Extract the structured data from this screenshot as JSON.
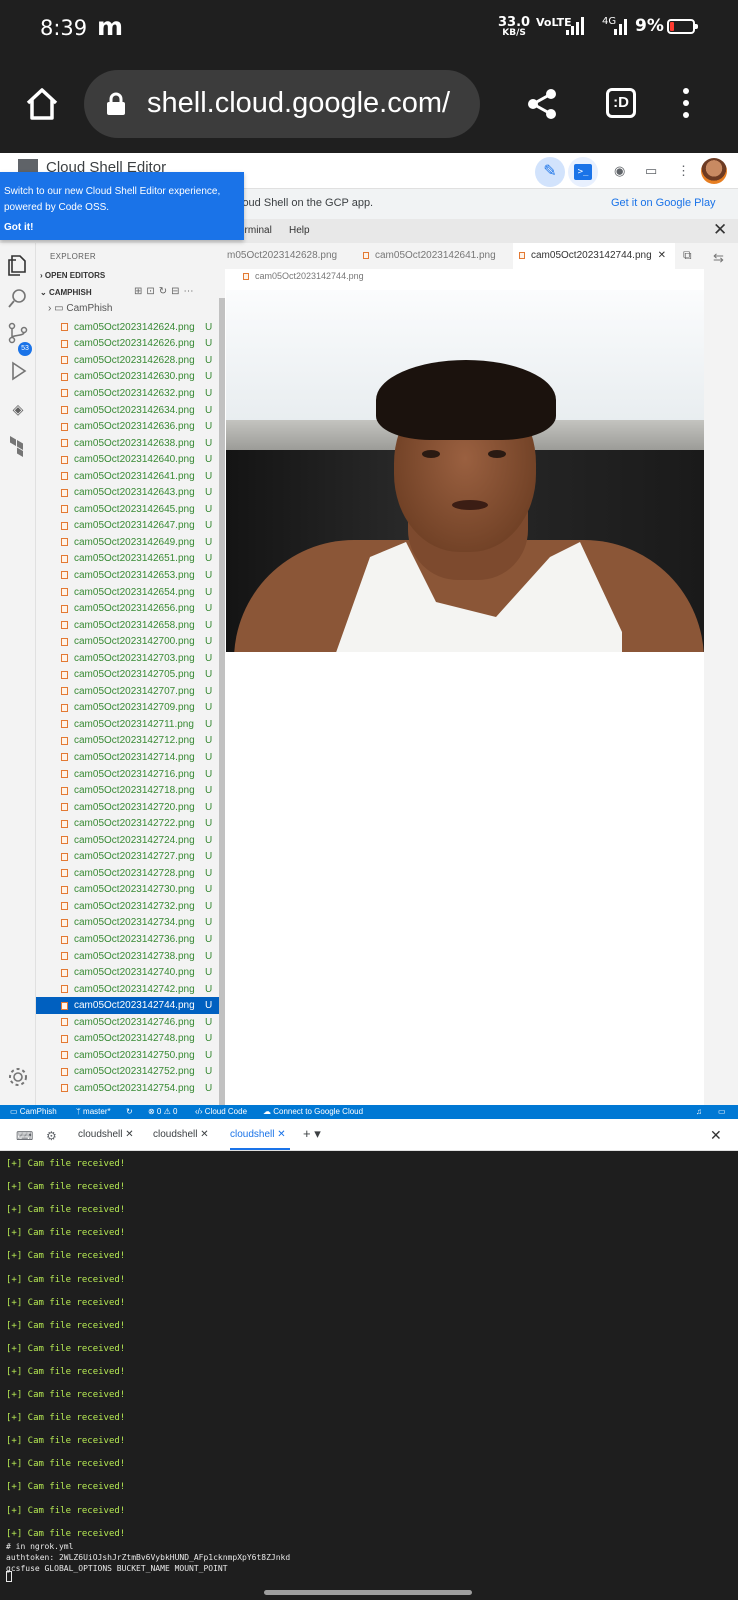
{
  "status_bar": {
    "time": "8:39",
    "app_icon": "m",
    "speed_value": "33.0",
    "speed_unit": "KB/S",
    "volte": "VoLTE",
    "network": "4G",
    "battery": "9%"
  },
  "browser": {
    "url": "shell.cloud.google.com/",
    "tabs_label": ":D"
  },
  "cloud_shell": {
    "title": "Cloud Shell Editor",
    "gcp_banner": "loud Shell on the GCP app.",
    "gcp_link": "Get it on Google Play",
    "menu": [
      "erminal",
      "Help"
    ],
    "promo_text": "Switch to our new Cloud Shell Editor experience, powered by Code OSS.",
    "promo_button": "Got it!"
  },
  "explorer": {
    "header": "EXPLORER",
    "open_editors": "OPEN EDITORS",
    "workspace": "CAMPHISH",
    "folder": "CamPhish",
    "files": [
      "cam05Oct2023142624.png",
      "cam05Oct2023142626.png",
      "cam05Oct2023142628.png",
      "cam05Oct2023142630.png",
      "cam05Oct2023142632.png",
      "cam05Oct2023142634.png",
      "cam05Oct2023142636.png",
      "cam05Oct2023142638.png",
      "cam05Oct2023142640.png",
      "cam05Oct2023142641.png",
      "cam05Oct2023142643.png",
      "cam05Oct2023142645.png",
      "cam05Oct2023142647.png",
      "cam05Oct2023142649.png",
      "cam05Oct2023142651.png",
      "cam05Oct2023142653.png",
      "cam05Oct2023142654.png",
      "cam05Oct2023142656.png",
      "cam05Oct2023142658.png",
      "cam05Oct2023142700.png",
      "cam05Oct2023142703.png",
      "cam05Oct2023142705.png",
      "cam05Oct2023142707.png",
      "cam05Oct2023142709.png",
      "cam05Oct2023142711.png",
      "cam05Oct2023142712.png",
      "cam05Oct2023142714.png",
      "cam05Oct2023142716.png",
      "cam05Oct2023142718.png",
      "cam05Oct2023142720.png",
      "cam05Oct2023142722.png",
      "cam05Oct2023142724.png",
      "cam05Oct2023142727.png",
      "cam05Oct2023142728.png",
      "cam05Oct2023142730.png",
      "cam05Oct2023142732.png",
      "cam05Oct2023142734.png",
      "cam05Oct2023142736.png",
      "cam05Oct2023142738.png",
      "cam05Oct2023142740.png",
      "cam05Oct2023142742.png",
      "cam05Oct2023142744.png",
      "cam05Oct2023142746.png",
      "cam05Oct2023142748.png",
      "cam05Oct2023142750.png",
      "cam05Oct2023142752.png",
      "cam05Oct2023142754.png"
    ],
    "file_status": "U",
    "selected_file": "cam05Oct2023142744.png",
    "scm_badge": "53"
  },
  "editor": {
    "tabs": [
      "m05Oct2023142628.png",
      "cam05Oct2023142641.png",
      "cam05Oct2023142744.png"
    ],
    "active_tab": "cam05Oct2023142744.png",
    "breadcrumb": "cam05Oct2023142744.png"
  },
  "statusbar": {
    "workspace": "CamPhish",
    "branch": "master*",
    "problems": "⊗ 0 ⚠ 0",
    "cloud_code": "Cloud Code",
    "connect": "Connect to Google Cloud"
  },
  "terminal": {
    "tabs": [
      "cloudshell",
      "cloudshell",
      "cloudshell"
    ],
    "lines": [
      "[+] Cam file received!",
      "[+] Cam file received!",
      "[+] Cam file received!",
      "[+] Cam file received!",
      "[+] Cam file received!",
      "[+] Cam file received!",
      "[+] Cam file received!",
      "[+] Cam file received!",
      "[+] Cam file received!",
      "[+] Cam file received!",
      "[+] Cam file received!",
      "[+] Cam file received!",
      "[+] Cam file received!",
      "[+] Cam file received!",
      "[+] Cam file received!",
      "[+] Cam file received!",
      "[+] Cam file received!"
    ],
    "tail": [
      "# in ngrok.yml",
      "authtoken: 2WLZ6UiOJshJrZtmBv6VybkHUND_AFp1cknmpXpY6t8ZJnkd",
      "gcsfuse GLOBAL_OPTIONS BUCKET_NAME MOUNT_POINT"
    ]
  }
}
